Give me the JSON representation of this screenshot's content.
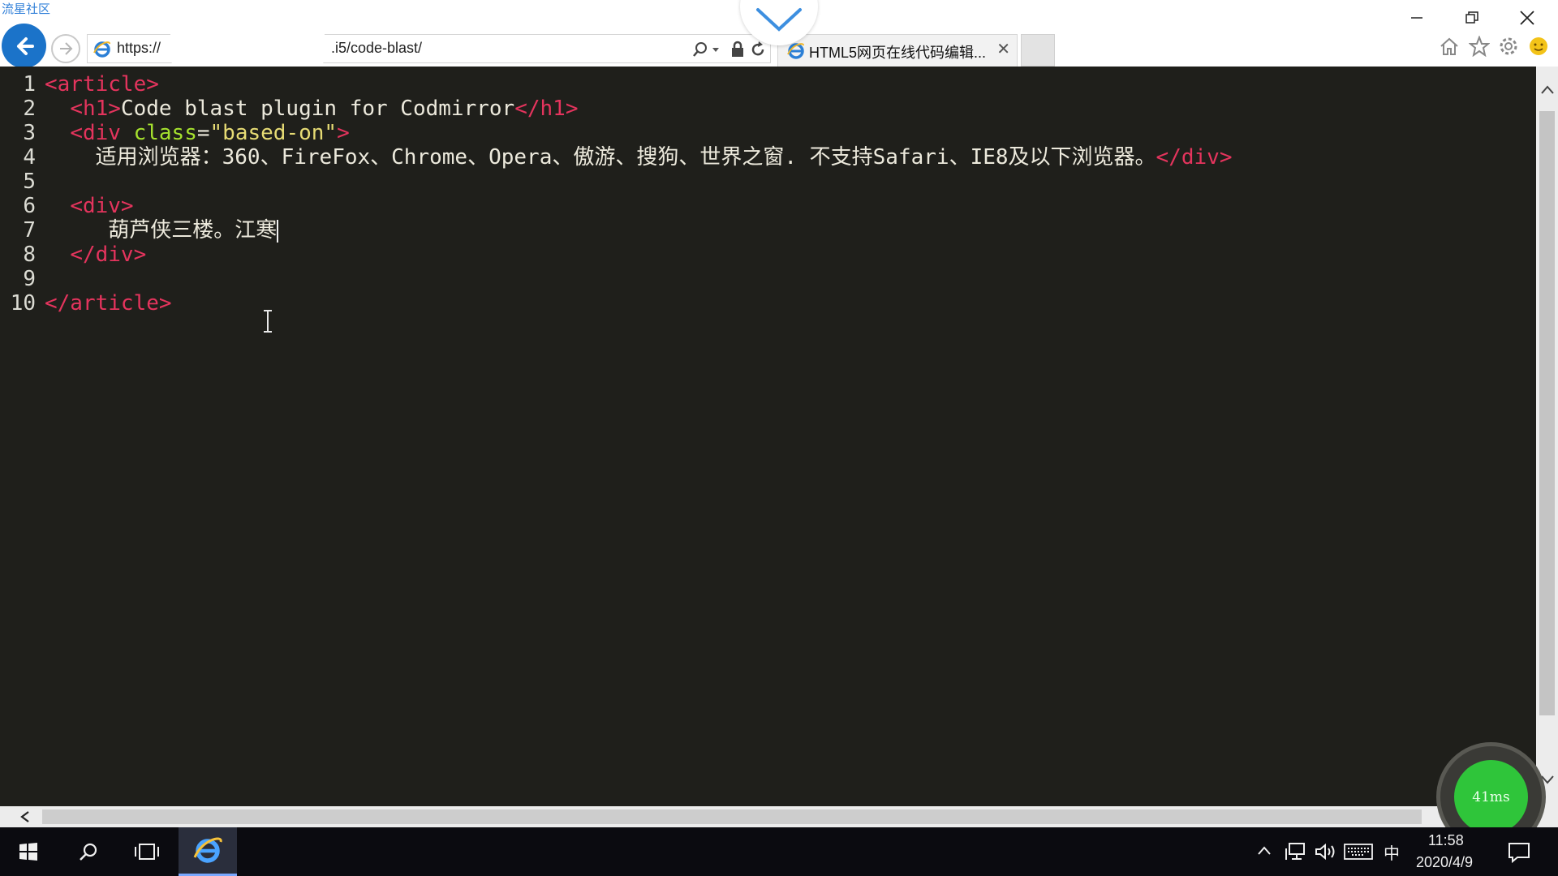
{
  "watermark": "流星社区",
  "browser": {
    "url_prefix": "https://",
    "url_suffix": ".i5/code-blast/",
    "tab_title": "HTML5网页在线代码编辑...",
    "tab_close": "✕"
  },
  "editor": {
    "lines": [
      {
        "num": "1",
        "indent": "",
        "parts": [
          {
            "c": "tag",
            "t": "<article>"
          }
        ]
      },
      {
        "num": "2",
        "indent": "  ",
        "parts": [
          {
            "c": "tag",
            "t": "<h1>"
          },
          {
            "c": "txt",
            "t": "Code blast plugin for Codmirror"
          },
          {
            "c": "tag",
            "t": "</h1>"
          }
        ]
      },
      {
        "num": "3",
        "indent": "  ",
        "parts": [
          {
            "c": "tag",
            "t": "<div "
          },
          {
            "c": "attr",
            "t": "class"
          },
          {
            "c": "eq",
            "t": "="
          },
          {
            "c": "str",
            "t": "\"based-on\""
          },
          {
            "c": "tag",
            "t": ">"
          }
        ]
      },
      {
        "num": "4",
        "indent": "    ",
        "parts": [
          {
            "c": "txt",
            "t": "适用浏览器：360、FireFox、Chrome、Opera、傲游、搜狗、世界之窗. 不支持Safari、IE8及以下浏览器。"
          },
          {
            "c": "tag",
            "t": "</div>"
          }
        ]
      },
      {
        "num": "5",
        "indent": "",
        "parts": []
      },
      {
        "num": "6",
        "indent": "  ",
        "parts": [
          {
            "c": "tag",
            "t": "<div>"
          }
        ]
      },
      {
        "num": "7",
        "indent": "     ",
        "parts": [
          {
            "c": "txt",
            "t": "葫芦侠三楼。江寒"
          }
        ],
        "cursor": true
      },
      {
        "num": "8",
        "indent": "  ",
        "parts": [
          {
            "c": "tag",
            "t": "</div>"
          }
        ]
      },
      {
        "num": "9",
        "indent": "",
        "parts": []
      },
      {
        "num": "10",
        "indent": "",
        "parts": [
          {
            "c": "tag",
            "t": "</article>"
          }
        ]
      }
    ]
  },
  "speed": {
    "label": "41ms"
  },
  "taskbar": {
    "time": "11:58",
    "date": "2020/4/9",
    "ime": "中"
  },
  "colors": {
    "tag": "#e4345d",
    "attr": "#a6e22e",
    "string": "#e6db74",
    "text": "#ece9dc",
    "background": "#1f1f1b"
  }
}
